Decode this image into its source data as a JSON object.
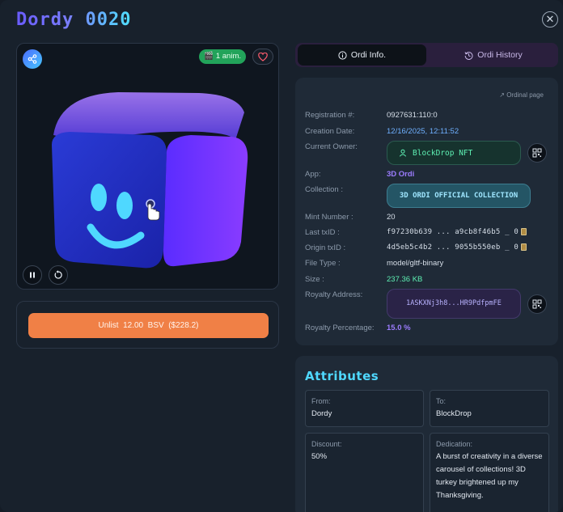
{
  "title": "Dordy 0020",
  "preview": {
    "anim_badge": "1 anim.",
    "icons": [
      "share-icon",
      "heart-icon",
      "pause-icon",
      "reset-icon",
      "cursor-icon"
    ]
  },
  "unlist": {
    "label": "Unlist  12.00  BSV  ($228.2)"
  },
  "tabs": [
    {
      "label": "Ordi Info.",
      "icon": "info-icon"
    },
    {
      "label": "Ordi History",
      "icon": "history-icon"
    }
  ],
  "info": {
    "ordinal_link": "Ordinal page",
    "rows": {
      "registration": {
        "label": "Registration #:",
        "value": "0927631:110:0"
      },
      "creation": {
        "label": "Creation Date:",
        "value": "12/16/2025, 12:11:52"
      },
      "owner": {
        "label": "Current Owner:",
        "value": "BlockDrop NFT"
      },
      "app": {
        "label": "App:",
        "value": "3D Ordi"
      },
      "collection": {
        "label": "Collection :",
        "value": "3D ORDI OFFICIAL COLLECTION"
      },
      "mint": {
        "label": "Mint Number :",
        "value": "20"
      },
      "last_txid": {
        "label": "Last txID :",
        "value": "f97230b639 ... a9cb8f46b5 _ 0"
      },
      "origin_txid": {
        "label": "Origin txID :",
        "value": "4d5eb5c4b2 ... 9055b550eb _ 0"
      },
      "file_type": {
        "label": "File Type :",
        "value": "model/gltf-binary"
      },
      "size": {
        "label": "Size :",
        "value": "237.36 KB"
      },
      "royalty_address": {
        "label": "Royalty Address:",
        "value": "1ASKXNj3h8...HR9PdfpmFE"
      },
      "royalty_pct": {
        "label": "Royalty Percentage:",
        "value": "15.0 %"
      }
    }
  },
  "attributes": {
    "title": "Attributes",
    "from": {
      "label": "From:",
      "value": "Dordy"
    },
    "to": {
      "label": "To:",
      "value": "BlockDrop"
    },
    "discount": {
      "label": "Discount:",
      "value": "50%"
    },
    "dedication": {
      "label": "Dedication:",
      "value": "A burst of creativity in a diverse carousel of collections! 3D turkey brightened up my Thanksgiving."
    }
  },
  "colors": {
    "accent_orange": "#f08046",
    "accent_cyan": "#4fd8ff",
    "owner_green": "#5ef0b3"
  }
}
